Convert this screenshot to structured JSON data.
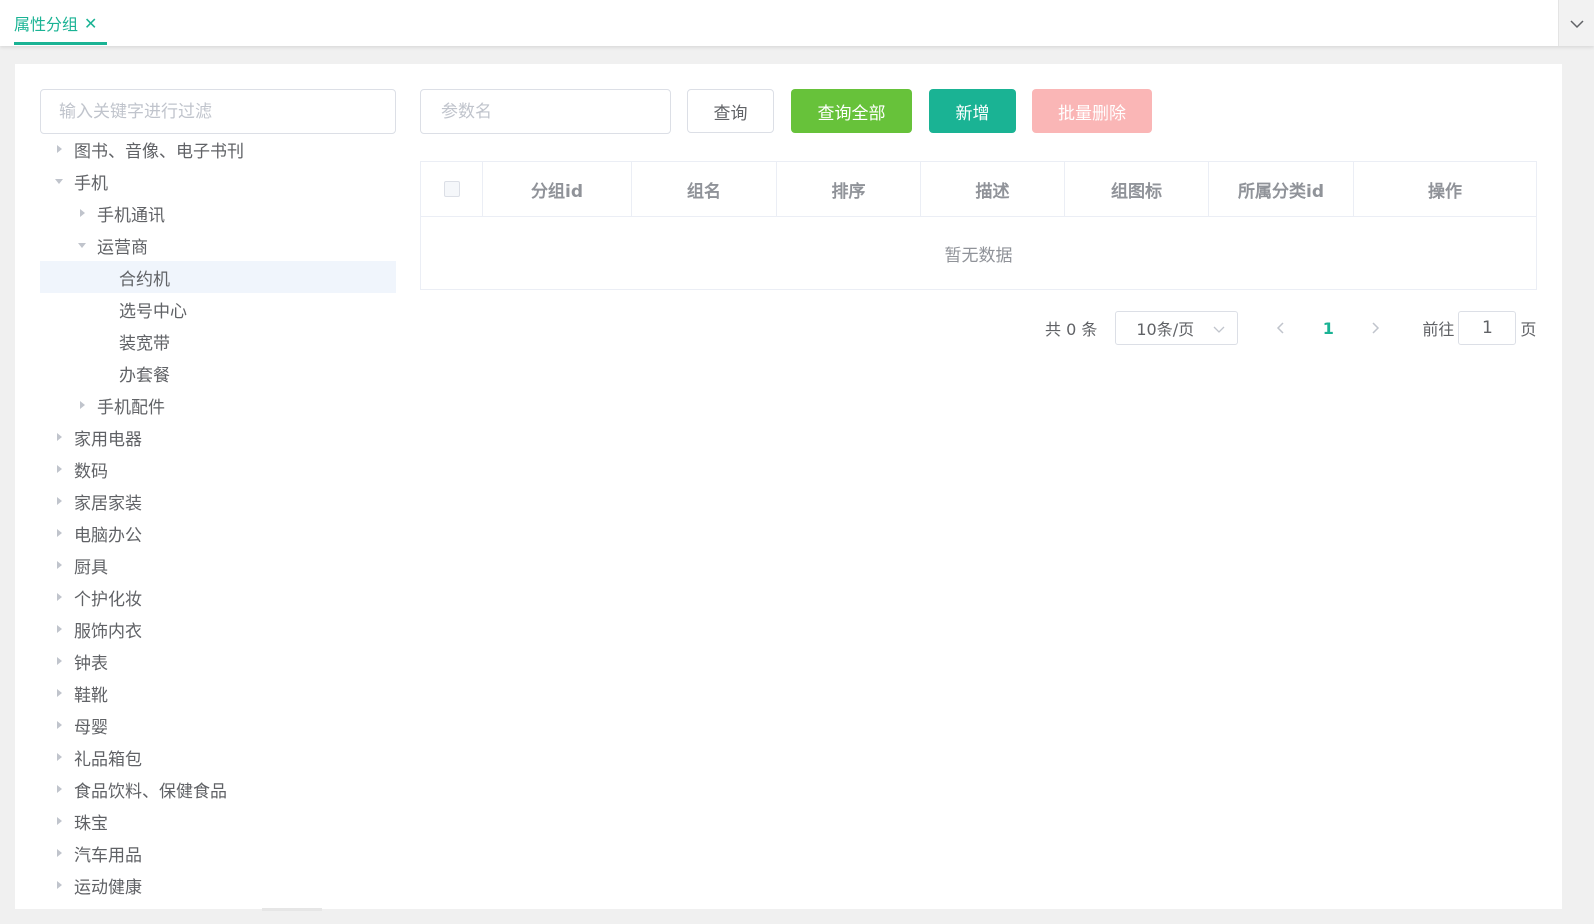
{
  "tabs": [
    {
      "label": "属性分组",
      "active": true
    }
  ],
  "colors": {
    "accent": "#1ab394",
    "success": "#67c23a",
    "danger_disabled": "#fab6b6"
  },
  "tree": {
    "filter_placeholder": "输入关键字进行过滤",
    "nodes": [
      {
        "label": "图书、音像、电子书刊",
        "level": 0,
        "state": "collapsed"
      },
      {
        "label": "手机",
        "level": 0,
        "state": "expanded"
      },
      {
        "label": "手机通讯",
        "level": 1,
        "state": "collapsed"
      },
      {
        "label": "运营商",
        "level": 1,
        "state": "expanded"
      },
      {
        "label": "合约机",
        "level": 2,
        "state": "leaf",
        "selected": true
      },
      {
        "label": "选号中心",
        "level": 2,
        "state": "leaf"
      },
      {
        "label": "装宽带",
        "level": 2,
        "state": "leaf"
      },
      {
        "label": "办套餐",
        "level": 2,
        "state": "leaf"
      },
      {
        "label": "手机配件",
        "level": 1,
        "state": "collapsed"
      },
      {
        "label": "家用电器",
        "level": 0,
        "state": "collapsed"
      },
      {
        "label": "数码",
        "level": 0,
        "state": "collapsed"
      },
      {
        "label": "家居家装",
        "level": 0,
        "state": "collapsed"
      },
      {
        "label": "电脑办公",
        "level": 0,
        "state": "collapsed"
      },
      {
        "label": "厨具",
        "level": 0,
        "state": "collapsed"
      },
      {
        "label": "个护化妆",
        "level": 0,
        "state": "collapsed"
      },
      {
        "label": "服饰内衣",
        "level": 0,
        "state": "collapsed"
      },
      {
        "label": "钟表",
        "level": 0,
        "state": "collapsed"
      },
      {
        "label": "鞋靴",
        "level": 0,
        "state": "collapsed"
      },
      {
        "label": "母婴",
        "level": 0,
        "state": "collapsed"
      },
      {
        "label": "礼品箱包",
        "level": 0,
        "state": "collapsed"
      },
      {
        "label": "食品饮料、保健食品",
        "level": 0,
        "state": "collapsed"
      },
      {
        "label": "珠宝",
        "level": 0,
        "state": "collapsed"
      },
      {
        "label": "汽车用品",
        "level": 0,
        "state": "collapsed"
      },
      {
        "label": "运动健康",
        "level": 0,
        "state": "collapsed"
      }
    ]
  },
  "toolbar": {
    "param_placeholder": "参数名",
    "query_label": "查询",
    "query_all_label": "查询全部",
    "add_label": "新增",
    "batch_delete_label": "批量删除"
  },
  "table": {
    "columns": [
      "分组id",
      "组名",
      "排序",
      "描述",
      "组图标",
      "所属分类id",
      "操作"
    ],
    "empty_text": "暂无数据"
  },
  "pagination": {
    "total_text": "共 0 条",
    "page_size": "10条/页",
    "current_page": "1",
    "goto_prefix": "前往",
    "goto_value": "1",
    "goto_suffix": "页"
  }
}
